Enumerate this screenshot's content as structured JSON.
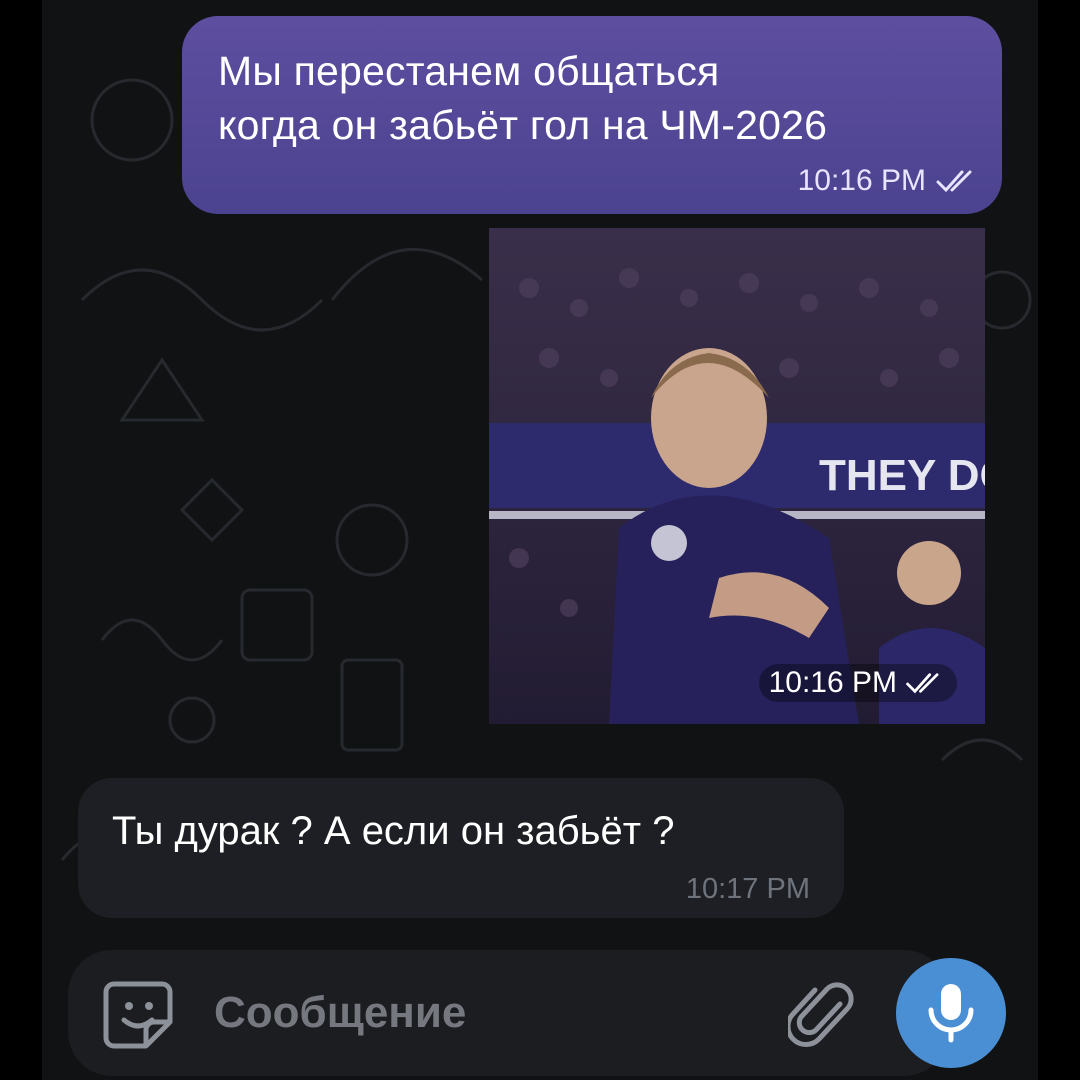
{
  "messages": {
    "outgoing_text": {
      "line1": "Мы перестанем общаться",
      "line2": "когда он забьёт гол на ЧМ-2026",
      "time": "10:16 PM"
    },
    "outgoing_media": {
      "banner_text": "THEY DO",
      "time": "10:16 PM"
    },
    "incoming_text": {
      "text": "Ты дурак ? А если он забьёт ?",
      "time": "10:17 PM"
    }
  },
  "composer": {
    "placeholder": "Сообщение"
  },
  "icons": {
    "sticker": "sticker-icon",
    "attach": "paperclip-icon",
    "mic": "microphone-icon",
    "read": "double-check-icon"
  },
  "colors": {
    "outgoing_bubble": "#5e4ea0",
    "incoming_bubble": "#1d1f24",
    "mic_button": "#4a8fd3",
    "background": "#101214"
  }
}
